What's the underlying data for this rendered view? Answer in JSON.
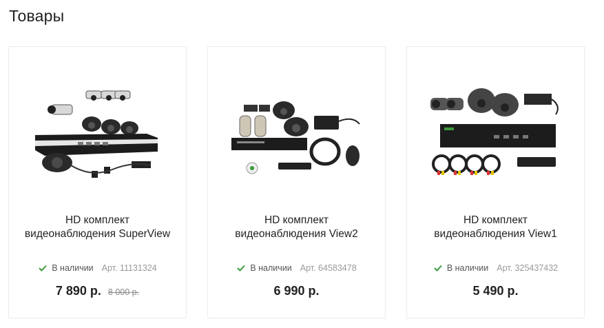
{
  "page": {
    "title": "Товары"
  },
  "colors": {
    "in_stock": "#3a9a3a",
    "text": "#222222",
    "muted": "#999999",
    "border": "#ececec"
  },
  "products": [
    {
      "name": "HD комплект видеонаблюдения SuperView",
      "stock": "В наличии",
      "article": "Арт. 11131324",
      "price": "7 890 р.",
      "old_price": "8 000 р.",
      "image_icon": "cctv-kit-image"
    },
    {
      "name": "HD комплект видеонаблюдения View2",
      "stock": "В наличии",
      "article": "Арт. 64583478",
      "price": "6 990 р.",
      "old_price": null,
      "image_icon": "cctv-kit-image"
    },
    {
      "name": "HD комплект видеонаблюдения View1",
      "stock": "В наличии",
      "article": "Арт. 325437432",
      "price": "5 490 р.",
      "old_price": null,
      "image_icon": "cctv-kit-image"
    }
  ]
}
